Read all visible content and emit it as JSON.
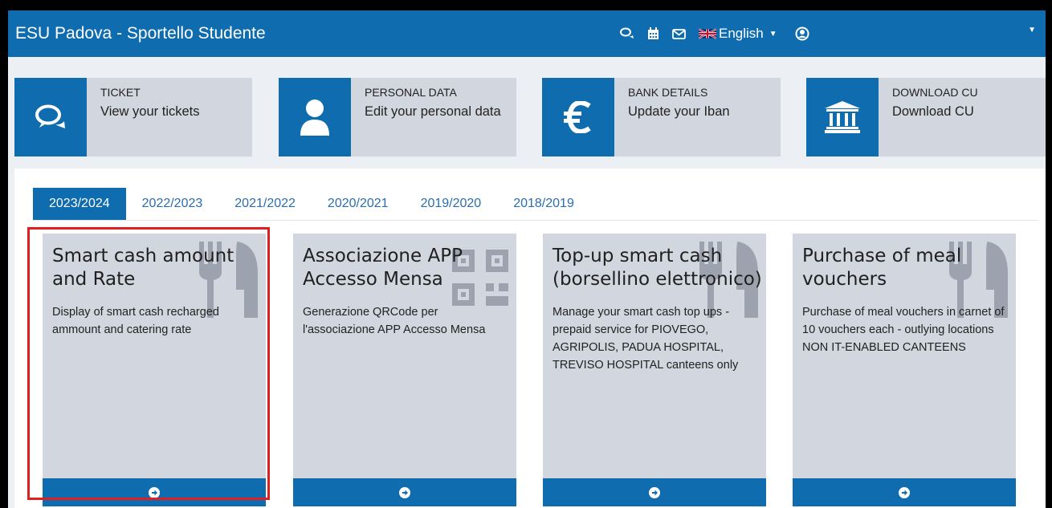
{
  "header": {
    "title": "ESU Padova - Sportello Studente",
    "language": "English",
    "icons": [
      "comments-icon",
      "calendar-icon",
      "mail-icon",
      "uk-flag-icon",
      "user-icon"
    ]
  },
  "quick_cards": [
    {
      "category": "TICKET",
      "text": "View your tickets",
      "icon": "comments-icon"
    },
    {
      "category": "PERSONAL DATA",
      "text": "Edit your personal data",
      "icon": "user-icon"
    },
    {
      "category": "BANK DETAILS",
      "text": "Update your Iban",
      "icon": "euro-icon"
    },
    {
      "category": "DOWNLOAD CU",
      "text": "Download CU",
      "icon": "bank-icon"
    }
  ],
  "tabs": [
    "2023/2024",
    "2022/2023",
    "2021/2022",
    "2020/2021",
    "2019/2020",
    "2018/2019"
  ],
  "active_tab": "2023/2024",
  "cards": [
    {
      "title": "Smart cash amount and Rate",
      "description": "Display of smart cash recharged ammount and catering rate",
      "icon": "cutlery-icon"
    },
    {
      "title": "Associazione APP Accesso Mensa",
      "description": "Generazione QRCode per l'associazione APP Accesso Mensa",
      "icon": "qrcode-icon"
    },
    {
      "title": "Top-up smart cash (borsellino elettronico)",
      "description": "Manage your smart cash top ups - prepaid service for PIOVEGO, AGRIPOLIS, PADUA HOSPITAL, TREVISO HOSPITAL canteens only",
      "icon": "cutlery-icon"
    },
    {
      "title": "Purchase of meal vouchers",
      "description": "Purchase of meal vouchers in carnet of 10 vouchers each - outlying locations NON IT-ENABLED CANTEENS",
      "icon": "cutlery-icon"
    }
  ],
  "colors": {
    "primary": "#0f6cae",
    "card_bg": "#d2d6de",
    "page_bg": "#ecf0f5",
    "highlight": "#e02020"
  }
}
